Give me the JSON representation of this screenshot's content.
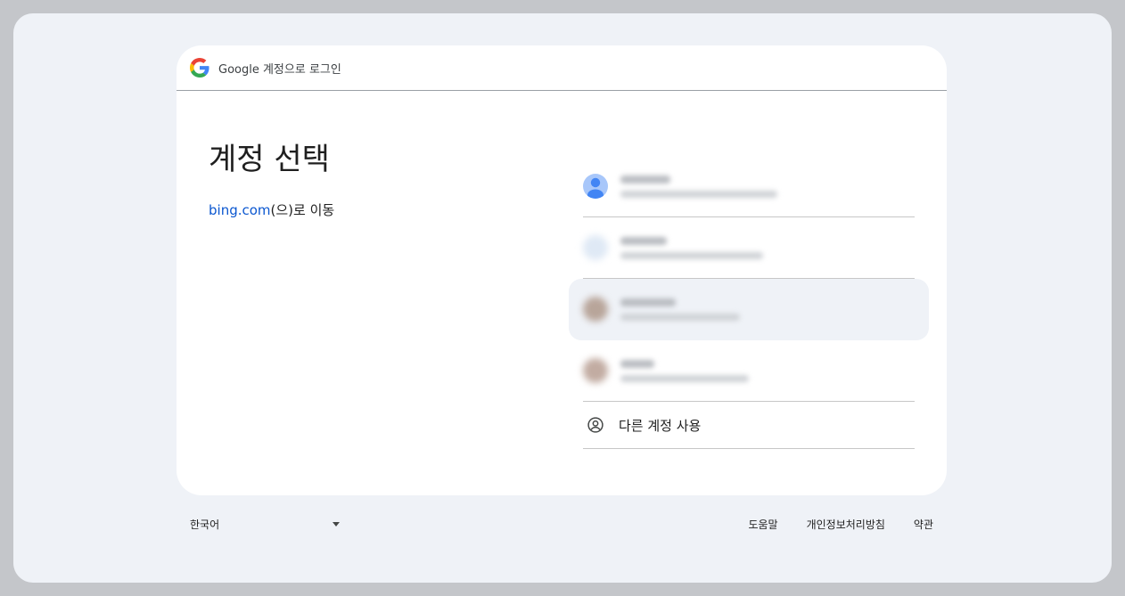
{
  "header": {
    "title": "Google 계정으로 로그인"
  },
  "main": {
    "heading": "계정 선택",
    "continue_link": "bing.com",
    "continue_suffix": "(으)로 이동"
  },
  "accounts": [
    {
      "avatar": "default-person-avatar",
      "blurred": true
    },
    {
      "avatar": "blurred-photo-avatar",
      "blurred": true
    },
    {
      "avatar": "blurred-photo-avatar",
      "blurred": true,
      "hovered": true
    },
    {
      "avatar": "blurred-photo-avatar",
      "blurred": true
    }
  ],
  "use_another": {
    "label": "다른 계정 사용",
    "icon": "account-circle-icon"
  },
  "footer": {
    "language": "한국어",
    "links": [
      "도움말",
      "개인정보처리방침",
      "약관"
    ]
  },
  "colors": {
    "link": "#0b57d0",
    "avatar_default": "#a8c7fa",
    "avatar_figure": "#4285f4",
    "hover_bg": "#eff2f7",
    "divider": "#c7c7c7"
  }
}
